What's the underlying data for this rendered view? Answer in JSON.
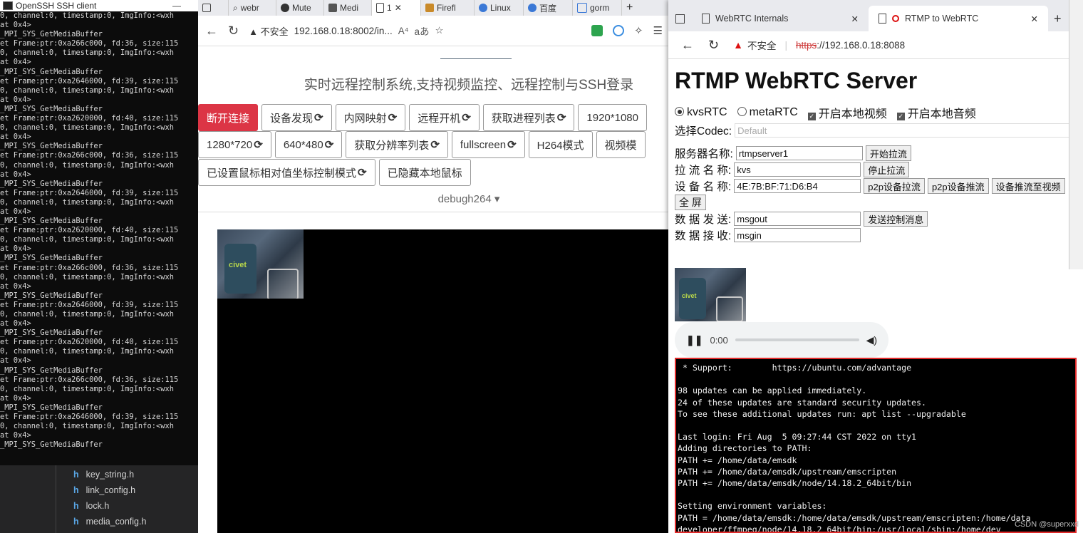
{
  "ssh": {
    "title": "OpenSSH SSH client",
    "min": "—",
    "log": "0, channel:0, timestamp:0, ImgInfo:<wxh\nat 0x4>\n_MPI_SYS_GetMediaBuffer\net Frame:ptr:0xa266c000, fd:36, size:115\n0, channel:0, timestamp:0, ImgInfo:<wxh\nat 0x4>\n_MPI_SYS_GetMediaBuffer\net Frame:ptr:0xa2646000, fd:39, size:115\n0, channel:0, timestamp:0, ImgInfo:<wxh\nat 0x4>\n_MPI_SYS_GetMediaBuffer\net Frame:ptr:0xa2620000, fd:40, size:115\n0, channel:0, timestamp:0, ImgInfo:<wxh\nat 0x4>\n_MPI_SYS_GetMediaBuffer\net Frame:ptr:0xa266c000, fd:36, size:115\n0, channel:0, timestamp:0, ImgInfo:<wxh\nat 0x4>\n_MPI_SYS_GetMediaBuffer\net Frame:ptr:0xa2646000, fd:39, size:115\n0, channel:0, timestamp:0, ImgInfo:<wxh\nat 0x4>\n_MPI_SYS_GetMediaBuffer\net Frame:ptr:0xa2620000, fd:40, size:115\n0, channel:0, timestamp:0, ImgInfo:<wxh\nat 0x4>\n_MPI_SYS_GetMediaBuffer\net Frame:ptr:0xa266c000, fd:36, size:115\n0, channel:0, timestamp:0, ImgInfo:<wxh\nat 0x4>\n_MPI_SYS_GetMediaBuffer\net Frame:ptr:0xa2646000, fd:39, size:115\n0, channel:0, timestamp:0, ImgInfo:<wxh\nat 0x4>\n_MPI_SYS_GetMediaBuffer\net Frame:ptr:0xa2620000, fd:40, size:115\n0, channel:0, timestamp:0, ImgInfo:<wxh\nat 0x4>\n_MPI_SYS_GetMediaBuffer\net Frame:ptr:0xa266c000, fd:36, size:115\n0, channel:0, timestamp:0, ImgInfo:<wxh\nat 0x4>\n_MPI_SYS_GetMediaBuffer\net Frame:ptr:0xa2646000, fd:39, size:115\n0, channel:0, timestamp:0, ImgInfo:<wxh\nat 0x4>\n_MPI_SYS_GetMediaBuffer",
    "files": [
      "key_string.h",
      "link_config.h",
      "lock.h",
      "media_config.h"
    ],
    "file_ext": "h"
  },
  "browser": {
    "tabs": [
      {
        "label": "",
        "icon": "tab-actions-icon"
      },
      {
        "label": "webr",
        "icon": "search-icon"
      },
      {
        "label": "Mute",
        "icon": "github-icon"
      },
      {
        "label": "Medi",
        "icon": "m-icon"
      },
      {
        "label": "1",
        "icon": "page-icon",
        "active": true,
        "close": "✕"
      },
      {
        "label": "Firefl",
        "icon": "fire-icon"
      },
      {
        "label": "Linux",
        "icon": "paw-icon"
      },
      {
        "label": "百度",
        "icon": "paw-icon"
      },
      {
        "label": "gorm",
        "icon": "doc-icon"
      }
    ],
    "newtab": "+",
    "security": "▲ 不安全",
    "url": "192.168.0.18:8002/in...",
    "read_aloud": "A⁴",
    "translate": "aあ",
    "subtitle": "实时远程控制系统,支持视频监控、远程控制与SSH登录",
    "row1": [
      "断开连接",
      "设备发现",
      "内网映射",
      "远程开机",
      "获取进程列表",
      "1920*1080"
    ],
    "row2": [
      "1280*720",
      "640*480",
      "获取分辨率列表",
      "fullscreen",
      "H264模式",
      "视频模"
    ],
    "row3": [
      "已设置鼠标相对值坐标控制模式",
      "已隐藏本地鼠标"
    ],
    "dropdown": "debugh264",
    "dropdown_caret": "▾",
    "refresh_glyph": "⟳",
    "thumb_logo": "civet"
  },
  "overlay": {
    "tabs": [
      {
        "label": "WebRTC Internals",
        "close": "✕"
      },
      {
        "label": "RTMP to WebRTC",
        "close": "✕",
        "active": true
      }
    ],
    "newtab": "+",
    "security": "不安全",
    "url_scheme": "https",
    "url_rest": "://192.168.0.18:8088",
    "heading": "RTMP WebRTC Server",
    "radio_kvs": "kvsRTC",
    "radio_meta": "metaRTC",
    "check_video": "开启本地视频",
    "check_audio": "开启本地音频",
    "codec_label": "选择Codec:",
    "codec_value": "Default",
    "server_label": "服务器名称:",
    "server_value": "rtmpserver1",
    "start_pull": "开始拉流",
    "stream_label": "拉 流 名 称:",
    "stream_value": "kvs",
    "stop_pull": "停止拉流",
    "device_label": "设 备 名 称:",
    "device_value": "4E:7B:BF:71:D6:B4",
    "p2p_pull": "p2p设备拉流",
    "p2p_push": "p2p设备推流",
    "device_push": "设备推流至视频",
    "fullscreen": "全 屏",
    "send_label": "数 据 发 送:",
    "send_value": "msgout",
    "send_btn": "发送控制消息",
    "recv_label": "数 据 接 收:",
    "recv_value": "msgin",
    "audio_time": "0:00",
    "terminal": " * Support:        https://ubuntu.com/advantage\n\n98 updates can be applied immediately.\n24 of these updates are standard security updates.\nTo see these additional updates run: apt list --upgradable\n\nLast login: Fri Aug  5 09:27:44 CST 2022 on tty1\nAdding directories to PATH:\nPATH += /home/data/emsdk\nPATH += /home/data/emsdk/upstream/emscripten\nPATH += /home/data/emsdk/node/14.18.2_64bit/bin\n\nSetting environment variables:\nPATH = /home/data/emsdk:/home/data/emsdk/upstream/emscripten:/home/data\ndeveloper/ffmpeg/node/14.18.2_64bit/bin:/usr/local/sbin:/home/dev",
    "watermark": "CSDN @superxxd"
  }
}
